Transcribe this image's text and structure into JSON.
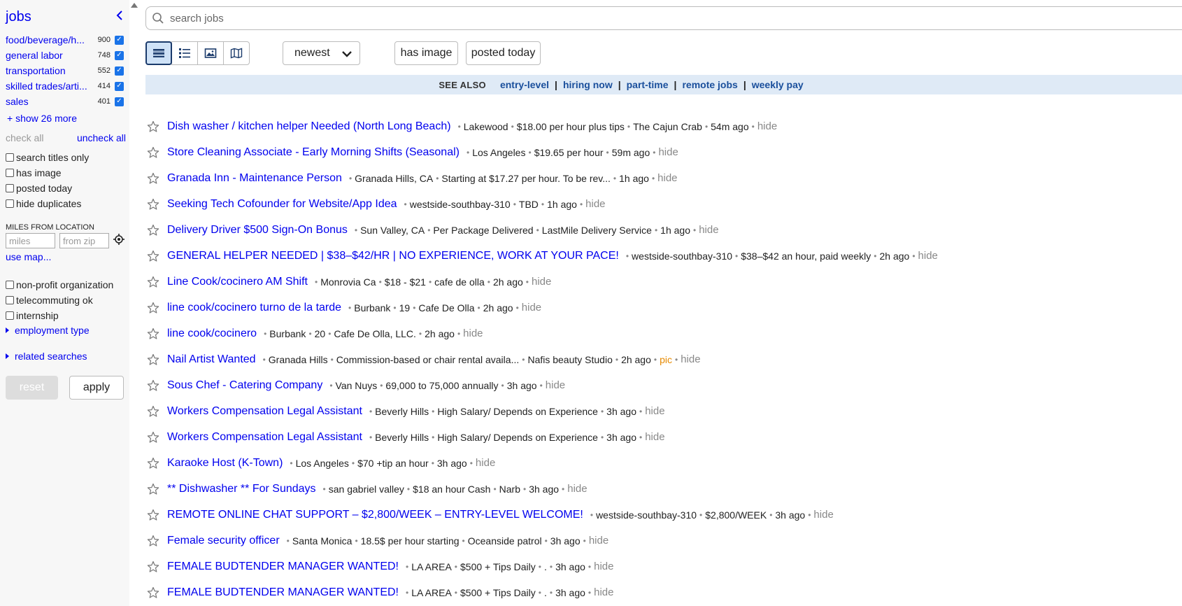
{
  "sidebar": {
    "title": "jobs",
    "categories": [
      {
        "name": "food/beverage/h...",
        "count": "900"
      },
      {
        "name": "general labor",
        "count": "748"
      },
      {
        "name": "transportation",
        "count": "552"
      },
      {
        "name": "skilled trades/arti...",
        "count": "414"
      },
      {
        "name": "sales",
        "count": "401"
      }
    ],
    "show_more": "+ show 26 more",
    "check_all": "check all",
    "uncheck_all": "uncheck all",
    "options": [
      "search titles only",
      "has image",
      "posted today",
      "hide duplicates"
    ],
    "miles_label": "MILES FROM LOCATION",
    "miles_placeholder": "miles",
    "zip_placeholder": "from zip",
    "use_map": "use map...",
    "options2": [
      "non-profit organization",
      "telecommuting ok",
      "internship"
    ],
    "employment_type": "employment type",
    "related_searches": "related searches",
    "reset": "reset",
    "apply": "apply"
  },
  "search": {
    "placeholder": "search jobs"
  },
  "toolbar": {
    "sort": "newest",
    "has_image": "has image",
    "posted_today": "posted today"
  },
  "see_also": {
    "label": "SEE ALSO",
    "links": [
      "entry-level",
      "hiring now",
      "part-time",
      "remote jobs",
      "weekly pay"
    ]
  },
  "results": [
    {
      "title": "Dish washer / kitchen helper Needed (North Long Beach)",
      "meta": [
        "Lakewood",
        "$18.00 per hour plus tips",
        "The Cajun Crab",
        "54m ago"
      ],
      "pic": "",
      "hide": "hide"
    },
    {
      "title": "Store Cleaning Associate - Early Morning Shifts (Seasonal)",
      "meta": [
        "Los Angeles",
        "$19.65 per hour",
        "59m ago"
      ],
      "pic": "",
      "hide": "hide"
    },
    {
      "title": "Granada Inn - Maintenance Person",
      "meta": [
        "Granada Hills, CA",
        "Starting at $17.27 per hour.  To be rev...",
        "1h ago"
      ],
      "pic": "",
      "hide": "hide"
    },
    {
      "title": "Seeking Tech Cofounder for Website/App Idea",
      "meta": [
        "westside-southbay-310",
        "TBD",
        "1h ago"
      ],
      "pic": "",
      "hide": "hide"
    },
    {
      "title": "Delivery Driver $500 Sign-On Bonus",
      "meta": [
        "Sun Valley, CA",
        "Per Package Delivered",
        "LastMile Delivery Service",
        "1h ago"
      ],
      "pic": "",
      "hide": "hide"
    },
    {
      "title": "GENERAL HELPER NEEDED | $38–$42/HR | NO EXPERIENCE, WORK AT YOUR PACE!",
      "meta": [
        "westside-southbay-310",
        "$38–$42 an hour, paid weekly",
        "2h ago"
      ],
      "pic": "",
      "hide": "hide"
    },
    {
      "title": "Line Cook/cocinero AM Shift",
      "meta": [
        "Monrovia Ca",
        "$18 - $21",
        "cafe de olla",
        "2h ago"
      ],
      "pic": "",
      "hide": "hide"
    },
    {
      "title": "line cook/cocinero turno de la tarde",
      "meta": [
        "Burbank",
        "19",
        "Cafe De Olla",
        "2h ago"
      ],
      "pic": "",
      "hide": "hide"
    },
    {
      "title": "line cook/cocinero",
      "meta": [
        "Burbank",
        "20",
        "Cafe De Olla, LLC.",
        "2h ago"
      ],
      "pic": "",
      "hide": "hide"
    },
    {
      "title": "Nail Artist Wanted",
      "meta": [
        "Granada Hills",
        "Commission-based or chair rental availa...",
        "Nafis beauty Studio",
        "2h ago"
      ],
      "pic": "pic",
      "hide": "hide"
    },
    {
      "title": "Sous Chef - Catering Company",
      "meta": [
        "Van Nuys",
        "69,000 to 75,000 annually",
        "3h ago"
      ],
      "pic": "",
      "hide": "hide"
    },
    {
      "title": "Workers Compensation Legal Assistant",
      "meta": [
        "Beverly Hills",
        "High Salary/ Depends on Experience",
        "3h ago"
      ],
      "pic": "",
      "hide": "hide"
    },
    {
      "title": "Workers Compensation Legal Assistant",
      "meta": [
        "Beverly Hills",
        "High Salary/ Depends on Experience",
        "3h ago"
      ],
      "pic": "",
      "hide": "hide"
    },
    {
      "title": "Karaoke Host (K-Town)",
      "meta": [
        "Los Angeles",
        "$70 +tip an hour",
        "3h ago"
      ],
      "pic": "",
      "hide": "hide"
    },
    {
      "title": "** Dishwasher ** For Sundays",
      "meta": [
        "san gabriel valley",
        "$18 an hour Cash",
        "Narb",
        "3h ago"
      ],
      "pic": "",
      "hide": "hide"
    },
    {
      "title": "REMOTE ONLINE CHAT SUPPORT – $2,800/WEEK – ENTRY-LEVEL WELCOME!",
      "meta": [
        "westside-southbay-310",
        "$2,800/WEEK",
        "3h ago"
      ],
      "pic": "",
      "hide": "hide"
    },
    {
      "title": "Female security officer",
      "meta": [
        "Santa Monica",
        "18.5$ per hour starting",
        "Oceanside patrol",
        "3h ago"
      ],
      "pic": "",
      "hide": "hide"
    },
    {
      "title": "FEMALE BUDTENDER MANAGER WANTED!",
      "meta": [
        "LA AREA",
        "$500 + Tips Daily",
        ".",
        "3h ago"
      ],
      "pic": "",
      "hide": "hide"
    },
    {
      "title": "FEMALE BUDTENDER MANAGER WANTED!",
      "meta": [
        "LA AREA",
        "$500 + Tips Daily",
        ".",
        "3h ago"
      ],
      "pic": "",
      "hide": "hide"
    }
  ]
}
